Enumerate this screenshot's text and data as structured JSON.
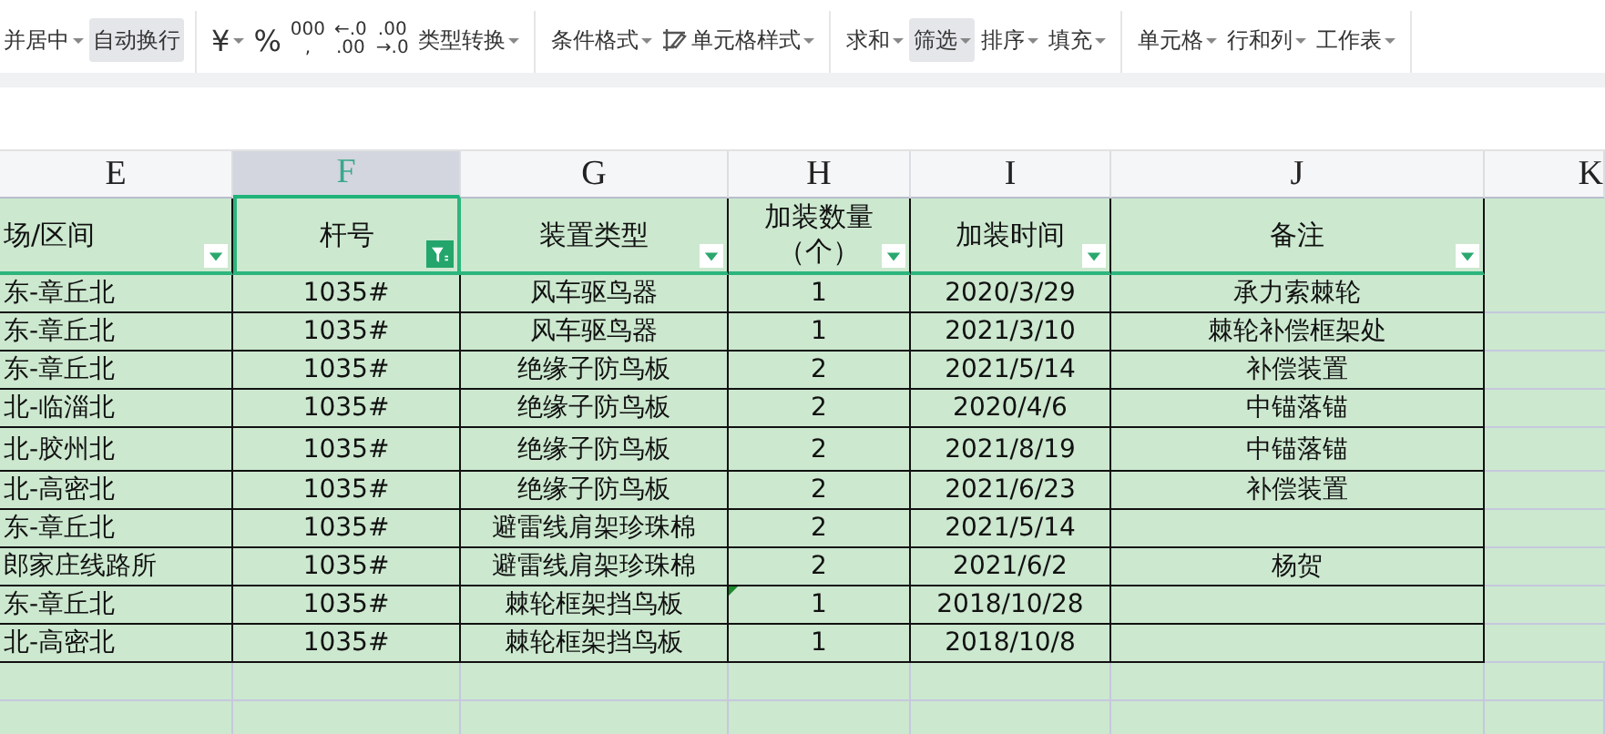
{
  "toolbar": {
    "groups": [
      {
        "items": [
          {
            "kind": "text",
            "label": "并居中",
            "dropdown": true,
            "selected": false
          },
          {
            "kind": "text",
            "label": "自动换行",
            "dropdown": false,
            "selected": true
          }
        ]
      },
      {
        "items": [
          {
            "kind": "symbol",
            "label": "¥",
            "dropdown": true,
            "selected": false
          },
          {
            "kind": "symbol",
            "label": "%",
            "dropdown": false,
            "selected": false
          },
          {
            "kind": "stack",
            "lines": [
              "000",
              ","
            ],
            "dropdown": false,
            "selected": false
          },
          {
            "kind": "stack",
            "lines": [
              "←.0",
              ".00"
            ],
            "dropdown": false,
            "selected": false
          },
          {
            "kind": "stack",
            "lines": [
              ".00",
              "→.0"
            ],
            "dropdown": false,
            "selected": false
          },
          {
            "kind": "text",
            "label": "类型转换",
            "dropdown": true,
            "selected": false
          }
        ]
      },
      {
        "items": [
          {
            "kind": "text",
            "label": "条件格式",
            "dropdown": true,
            "selected": false
          },
          {
            "kind": "brush",
            "label": "单元格样式",
            "dropdown": true,
            "selected": false
          }
        ]
      },
      {
        "items": [
          {
            "kind": "text",
            "label": "求和",
            "dropdown": true,
            "selected": false
          },
          {
            "kind": "text",
            "label": "筛选",
            "dropdown": true,
            "selected": true
          },
          {
            "kind": "text",
            "label": "排序",
            "dropdown": true,
            "selected": false
          },
          {
            "kind": "text",
            "label": "填充",
            "dropdown": true,
            "selected": false
          }
        ]
      },
      {
        "items": [
          {
            "kind": "text",
            "label": "单元格",
            "dropdown": true,
            "selected": false
          },
          {
            "kind": "text",
            "label": "行和列",
            "dropdown": true,
            "selected": false
          },
          {
            "kind": "text",
            "label": "工作表",
            "dropdown": true,
            "selected": false
          }
        ]
      }
    ]
  },
  "sheet": {
    "columns": [
      {
        "letter": "E",
        "header": [
          "场/区间"
        ],
        "filtered": false,
        "selected": false
      },
      {
        "letter": "F",
        "header": [
          "杆号"
        ],
        "filtered": true,
        "selected": true
      },
      {
        "letter": "G",
        "header": [
          "装置类型"
        ],
        "filtered": false,
        "selected": false
      },
      {
        "letter": "H",
        "header": [
          "加装数量",
          "（个）"
        ],
        "filtered": false,
        "selected": false
      },
      {
        "letter": "I",
        "header": [
          "加装时间"
        ],
        "filtered": false,
        "selected": false
      },
      {
        "letter": "J",
        "header": [
          "备注"
        ],
        "filtered": false,
        "selected": false
      },
      {
        "letter": "K",
        "selected": false
      }
    ],
    "rows": [
      {
        "cells": [
          "东-章丘北",
          "1035#",
          "风车驱鸟器",
          "1",
          "2020/3/29",
          "承力索棘轮"
        ],
        "flag": false
      },
      {
        "cells": [
          "东-章丘北",
          "1035#",
          "风车驱鸟器",
          "1",
          "2021/3/10",
          "棘轮补偿框架处"
        ],
        "flag": false
      },
      {
        "cells": [
          "东-章丘北",
          "1035#",
          "绝缘子防鸟板",
          "2",
          "2021/5/14",
          "补偿装置"
        ],
        "flag": false
      },
      {
        "cells": [
          "北-临淄北",
          "1035#",
          "绝缘子防鸟板",
          "2",
          "2020/4/6",
          "中锚落锚"
        ],
        "flag": false
      },
      {
        "cells": [
          "北-胶州北",
          "1035#",
          "绝缘子防鸟板",
          "2",
          "2021/8/19",
          "中锚落锚"
        ],
        "flag": false
      },
      {
        "cells": [
          "北-高密北",
          "1035#",
          "绝缘子防鸟板",
          "2",
          "2021/6/23",
          "补偿装置"
        ],
        "flag": false
      },
      {
        "cells": [
          "东-章丘北",
          "1035#",
          "避雷线肩架珍珠棉",
          "2",
          "2021/5/14"
        ],
        "flag": false
      },
      {
        "cells": [
          "郎家庄线路所",
          "1035#",
          "避雷线肩架珍珠棉",
          "2",
          "2021/6/2",
          "杨贺"
        ],
        "flag": false
      },
      {
        "cells": [
          "东-章丘北",
          "1035#",
          "棘轮框架挡鸟板",
          "1",
          "2018/10/28"
        ],
        "flag": true
      },
      {
        "cells": [
          "北-高密北",
          "1035#",
          "棘轮框架挡鸟板",
          "1",
          "2018/10/8"
        ],
        "flag": false
      }
    ]
  }
}
